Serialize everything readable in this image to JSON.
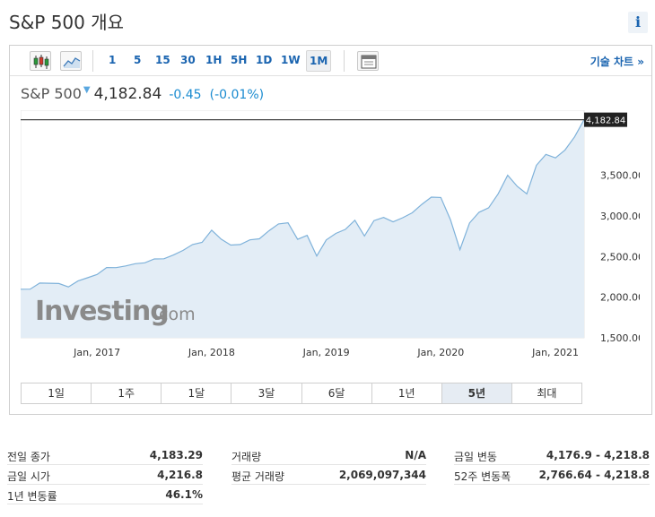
{
  "page": {
    "title": "S&P 500 개요",
    "info_icon": "i"
  },
  "toolbar": {
    "icons": [
      "candlestick-icon",
      "line-chart-icon",
      "calendar-icon"
    ],
    "intervals": [
      "1",
      "5",
      "15",
      "30",
      "1H",
      "5H",
      "1D",
      "1W",
      "1M"
    ],
    "active_interval": "1M",
    "advanced_link": "기술 차트 »"
  },
  "quote": {
    "name": "S&P 500",
    "arrow": "▼",
    "price": "4,182.84",
    "change": "-0.45",
    "change_pct": "(-0.01%)"
  },
  "chart_data": {
    "type": "area",
    "x_ticks": [
      "Jan, 2017",
      "Jan, 2018",
      "Jan, 2019",
      "Jan, 2020",
      "Jan, 2021"
    ],
    "y_ticks": [
      "1,500.00",
      "2,000.00",
      "2,500.00",
      "3,000.00",
      "3,500.00"
    ],
    "ylim": [
      1500,
      4300
    ],
    "last_value_label": "4,182.84",
    "last_value": 4182.84,
    "watermark": "Investing.com",
    "colors": {
      "line": "#7fb2da",
      "fill": "#e3edf6",
      "price_line": "#444444"
    },
    "x": [
      "2016-05",
      "2016-06",
      "2016-07",
      "2016-08",
      "2016-09",
      "2016-10",
      "2016-11",
      "2016-12",
      "2017-01",
      "2017-02",
      "2017-03",
      "2017-04",
      "2017-05",
      "2017-06",
      "2017-07",
      "2017-08",
      "2017-09",
      "2017-10",
      "2017-11",
      "2017-12",
      "2018-01",
      "2018-02",
      "2018-03",
      "2018-04",
      "2018-05",
      "2018-06",
      "2018-07",
      "2018-08",
      "2018-09",
      "2018-10",
      "2018-11",
      "2018-12",
      "2019-01",
      "2019-02",
      "2019-03",
      "2019-04",
      "2019-05",
      "2019-06",
      "2019-07",
      "2019-08",
      "2019-09",
      "2019-10",
      "2019-11",
      "2019-12",
      "2020-01",
      "2020-02",
      "2020-03",
      "2020-04",
      "2020-05",
      "2020-06",
      "2020-07",
      "2020-08",
      "2020-09",
      "2020-10",
      "2020-11",
      "2020-12",
      "2021-01",
      "2021-02",
      "2021-03",
      "2021-04"
    ],
    "values": [
      2097,
      2099,
      2174,
      2171,
      2168,
      2126,
      2199,
      2239,
      2279,
      2364,
      2363,
      2384,
      2412,
      2423,
      2470,
      2472,
      2519,
      2575,
      2648,
      2674,
      2824,
      2714,
      2641,
      2648,
      2705,
      2718,
      2816,
      2901,
      2914,
      2712,
      2760,
      2507,
      2704,
      2784,
      2834,
      2946,
      2752,
      2942,
      2980,
      2926,
      2977,
      3038,
      3141,
      3231,
      3226,
      2954,
      2585,
      2912,
      3044,
      3100,
      3271,
      3500,
      3363,
      3270,
      3622,
      3756,
      3714,
      3811,
      3973,
      4183
    ]
  },
  "ranges": {
    "items": [
      "1일",
      "1주",
      "1달",
      "3달",
      "6달",
      "1년",
      "5년",
      "최대"
    ],
    "active": "5년"
  },
  "stats": {
    "col1": [
      {
        "label": "전일 종가",
        "value": "4,183.29"
      },
      {
        "label": "금일 시가",
        "value": "4,216.8"
      },
      {
        "label": "1년 변동률",
        "value": "46.1%"
      }
    ],
    "col2": [
      {
        "label": "거래량",
        "value": "N/A"
      },
      {
        "label": "평균 거래량",
        "value": "2,069,097,344"
      }
    ],
    "col3": [
      {
        "label": "금일 변동",
        "value": "4,176.9 - 4,218.8"
      },
      {
        "label": "52주 변동폭",
        "value": "2,766.64 - 4,218.8"
      }
    ]
  }
}
